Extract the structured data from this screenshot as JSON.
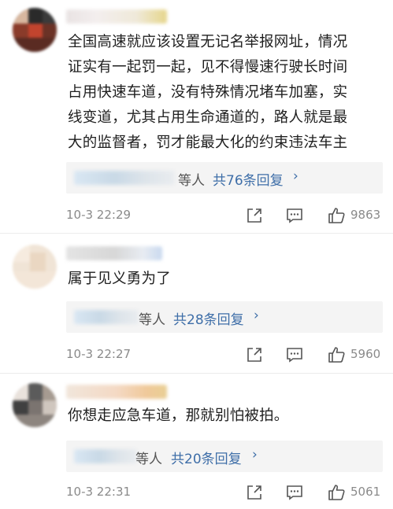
{
  "comments": [
    {
      "text_lines": [
        "全国高速就应该设置无记名举报网址，情况",
        "证实有一起罚一起，见不得慢速行驶长时间",
        "占用快速车道，没有特殊情况堵车加塞，实",
        "线变道，尤其占用生命通道的，路人就是最",
        "大的监督者，罚才能最大化的约束违法车主"
      ],
      "reply_suffix": "等人",
      "reply_count": "共76条回复",
      "time": "10-3 22:29",
      "likes": "9863"
    },
    {
      "text_lines": [
        "属于见义勇为了"
      ],
      "reply_suffix": "等人",
      "reply_count": "共28条回复",
      "time": "10-3 22:27",
      "likes": "5960"
    },
    {
      "text_lines": [
        "你想走应急车道，那就别怕被拍。"
      ],
      "reply_suffix": "等人",
      "reply_count": "共20条回复",
      "time": "10-3 22:31",
      "likes": "5061"
    }
  ],
  "icons": {
    "share": "share-icon",
    "comment": "comment-icon",
    "like": "thumbs-up-icon",
    "chevron": "chevron-right-icon"
  },
  "colors": {
    "link": "#3e6ea8",
    "meta": "#8a8a8a",
    "reply_bg": "#f4f4f4"
  }
}
